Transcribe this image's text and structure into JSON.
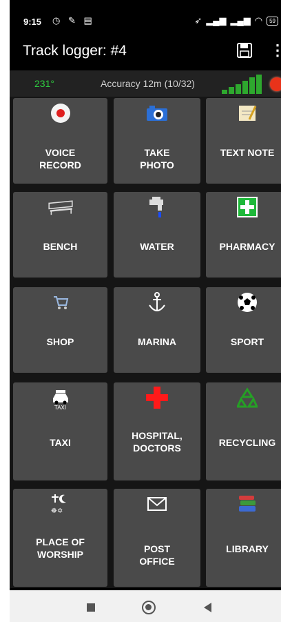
{
  "status": {
    "time": "9:15",
    "battery": "59"
  },
  "appbar": {
    "title": "Track logger: #4"
  },
  "info": {
    "heading": "231°",
    "accuracy": "Accuracy 12m (10/32)"
  },
  "buttons": [
    {
      "label": "VOICE RECORD",
      "icon": "record-icon"
    },
    {
      "label": "TAKE PHOTO",
      "icon": "camera-icon"
    },
    {
      "label": "TEXT NOTE",
      "icon": "note-icon"
    },
    {
      "label": "BENCH",
      "icon": "bench-icon"
    },
    {
      "label": "WATER",
      "icon": "water-tap-icon"
    },
    {
      "label": "PHARMACY",
      "icon": "pharmacy-icon"
    },
    {
      "label": "SHOP",
      "icon": "shopping-cart-icon"
    },
    {
      "label": "MARINA",
      "icon": "anchor-icon"
    },
    {
      "label": "SPORT",
      "icon": "soccer-ball-icon"
    },
    {
      "label": "TAXI",
      "icon": "taxi-icon",
      "icon_text": "TAXI"
    },
    {
      "label": "HOSPITAL, DOCTORS",
      "icon": "red-cross-icon"
    },
    {
      "label": "RECYCLING",
      "icon": "recycling-icon"
    },
    {
      "label": "PLACE OF WORSHIP",
      "icon": "worship-icon"
    },
    {
      "label": "POST OFFICE",
      "icon": "envelope-icon"
    },
    {
      "label": "LIBRARY",
      "icon": "books-icon"
    }
  ],
  "colors": {
    "heading": "#2ecc40",
    "record": "#e8331a",
    "button_bg": "#4a4a4a"
  }
}
